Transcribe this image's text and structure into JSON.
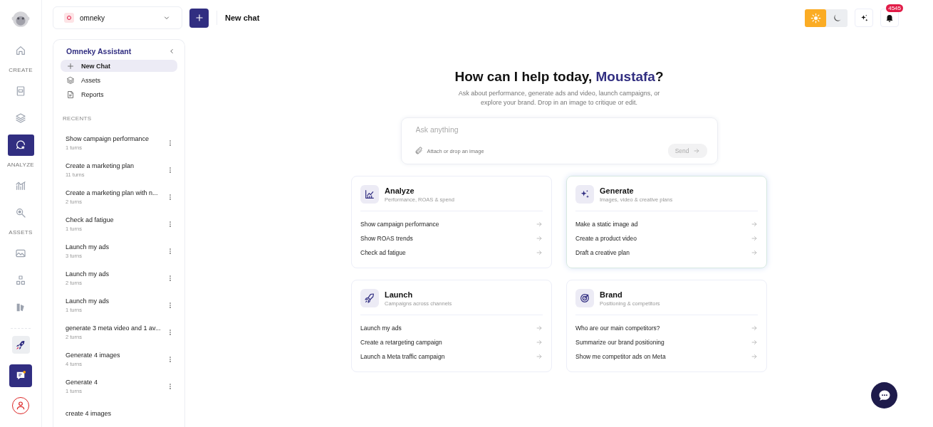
{
  "rail": [
    {
      "kind": "logo"
    },
    {
      "kind": "icon",
      "selected": false
    },
    {
      "kind": "label",
      "text": "CREATE"
    },
    {
      "kind": "icon",
      "selected": false
    },
    {
      "kind": "icon",
      "selected": false
    },
    {
      "kind": "icon",
      "selected": true
    },
    {
      "kind": "label",
      "text": "ANALYZE"
    },
    {
      "kind": "icon",
      "selected": false
    },
    {
      "kind": "icon",
      "selected": false
    },
    {
      "kind": "label",
      "text": "ASSETS"
    },
    {
      "kind": "icon",
      "selected": false
    },
    {
      "kind": "icon",
      "selected": false
    },
    {
      "kind": "icon",
      "selected": false
    },
    {
      "kind": "divider"
    },
    {
      "kind": "tile",
      "selected": false
    }
  ],
  "workspace": {
    "name": "omneky"
  },
  "header": {
    "title": "New chat",
    "theme": [
      {
        "selected": true
      },
      {
        "selected": false
      }
    ],
    "notifications": "4545"
  },
  "sidebar": {
    "title": "Omneky Assistant",
    "nav": [
      {
        "label": "New Chat",
        "selected": true
      },
      {
        "label": "Assets",
        "selected": false
      },
      {
        "label": "Reports",
        "selected": false
      }
    ],
    "recents_label": "RECENTS",
    "recents": [
      {
        "title": "Show campaign performance",
        "turns": "1 turns"
      },
      {
        "title": "Create a marketing plan",
        "turns": "11 turns"
      },
      {
        "title": "Create a marketing plan with n...",
        "turns": "2 turns"
      },
      {
        "title": "Check ad fatigue",
        "turns": "1 turns"
      },
      {
        "title": "Launch my ads",
        "turns": "3 turns"
      },
      {
        "title": "Launch my ads",
        "turns": "2 turns"
      },
      {
        "title": "Launch my ads",
        "turns": "1 turns"
      },
      {
        "title": "generate 3 meta video and 1 av...",
        "turns": "2 turns"
      },
      {
        "title": "Generate 4 images",
        "turns": "4 turns"
      },
      {
        "title": "Generate 4",
        "turns": "1 turns"
      },
      {
        "title": "create 4 images"
      }
    ]
  },
  "hero": {
    "greeting": "How can I help today, ",
    "name": "Moustafa",
    "greeting_end": "?",
    "subtitle": "Ask about performance, generate ads and video, launch campaigns, or explore your brand. Drop in an image to critique or edit."
  },
  "composer": {
    "placeholder": "Ask anything",
    "attach": "Attach or drop an image",
    "send": "Send",
    "send_disabled": true
  },
  "cards": [
    {
      "title": "Analyze",
      "subtitle": "Performance, ROAS & spend",
      "highlighted": false,
      "items": [
        "Show campaign performance",
        "Show ROAS trends",
        "Check ad fatigue"
      ]
    },
    {
      "title": "Generate",
      "subtitle": "Images, video & creative plans",
      "highlighted": true,
      "items": [
        "Make a static image ad",
        "Create a product video",
        "Draft a creative plan"
      ]
    },
    {
      "title": "Launch",
      "subtitle": "Campaigns across channels",
      "highlighted": false,
      "items": [
        "Launch my ads",
        "Create a retargeting campaign",
        "Launch a Meta traffic campaign"
      ]
    },
    {
      "title": "Brand",
      "subtitle": "Positioning & competitors",
      "highlighted": false,
      "items": [
        "Who are our main competitors?",
        "Summarize our brand positioning",
        "Show me competitor ads on Meta"
      ]
    }
  ]
}
